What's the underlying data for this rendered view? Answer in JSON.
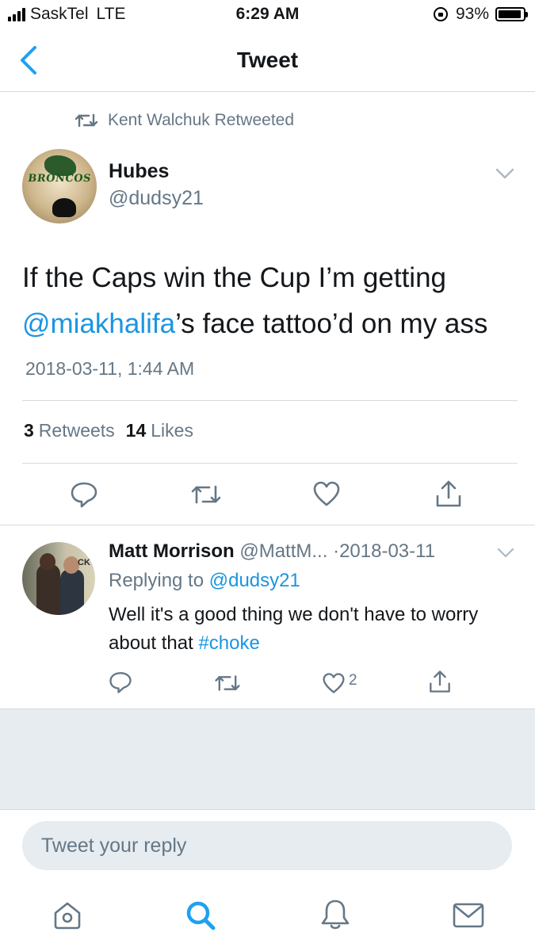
{
  "status_bar": {
    "carrier": "SaskTel",
    "network": "LTE",
    "time": "6:29 AM",
    "battery": "93%",
    "battery_level": 0.93
  },
  "nav": {
    "title": "Tweet",
    "back_icon": "chevron-left-icon"
  },
  "tweet": {
    "retweeted_by": "Kent Walchuk Retweeted",
    "author_name": "Hubes",
    "author_handle": "@dudsy21",
    "avatar_logo_text": "BRONCOS",
    "text_line1": "If the Caps win the Cup I’m getting",
    "text_mention": "@miakhalifa",
    "text_rest": "’s face tattoo’d on my ass",
    "timestamp": "2018-03-11, 1:44 AM",
    "retweets_count": "3",
    "retweets_label": "Retweets",
    "likes_count": "14",
    "likes_label": "Likes",
    "actions": [
      "reply-icon",
      "retweet-icon",
      "like-icon",
      "share-icon"
    ]
  },
  "reply": {
    "author_name": "Matt Morrison",
    "author_handle": "@MattM...",
    "separator": "·",
    "date": "2018-03-11",
    "avatar_sign_text": "CK",
    "replying_prefix": "Replying to",
    "replying_handle": "@dudsy21",
    "text_main": "Well it's a good thing we don't have to worry about that",
    "hashtag": "#choke",
    "like_count": "2"
  },
  "composer": {
    "placeholder": "Tweet your reply"
  },
  "tab_bar": {
    "items": [
      "home-icon",
      "search-icon",
      "notifications-icon",
      "messages-icon"
    ],
    "active": "search-icon"
  },
  "colors": {
    "accent": "#1da1f2",
    "link": "#1b95e0",
    "secondary_text": "#657786",
    "divider": "#d6d9dc",
    "background_grey": "#e6ecf0"
  }
}
